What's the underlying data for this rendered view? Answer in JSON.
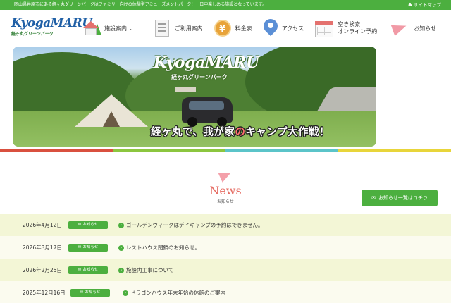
{
  "topbar": {
    "tagline": "岡山県井原市にある経ヶ丸グリーンパークはファミリー向けの体験型アミューズメントパーク！一日中楽しめる施設となっています。",
    "sitemap_label": "サイトマップ",
    "sitemap_icon": "sitemap-icon"
  },
  "logo": {
    "mark": "KyogaMARU",
    "sub": "経ヶ丸グリーンパーク"
  },
  "nav": {
    "items": [
      {
        "label": "施設案内",
        "icon": "facility-icon",
        "has_dropdown": true
      },
      {
        "label": "ご利用案内",
        "icon": "guide-document-icon"
      },
      {
        "label": "料金表",
        "icon": "yen-icon",
        "icon_glyph": "¥"
      },
      {
        "label": "アクセス",
        "icon": "map-pin-icon"
      },
      {
        "label": "空き検索\nオンライン予約",
        "icon": "calendar-icon"
      },
      {
        "label": "お知らせ",
        "icon": "megaphone-icon"
      }
    ],
    "dropdown_glyph": "⌄"
  },
  "hero": {
    "logo_mark": "KyogaMARU",
    "logo_sub": "経ヶ丸グリーンパーク",
    "catch_pre": "経ヶ丸で、我が家",
    "catch_accent": "の",
    "catch_post": "キャンプ大作戦！"
  },
  "stripe_colors": [
    "#d9503f",
    "#8cc63f",
    "#5bc4c9",
    "#e8d53a"
  ],
  "news": {
    "title": "News",
    "subtitle": "お知らせ",
    "list_button": "お知らせ一覧はコチラ",
    "badge_label": "お知らせ",
    "items": [
      {
        "date": "2026年4月12日",
        "title": "ゴールデンウィークはデイキャンプの予約はできません。"
      },
      {
        "date": "2026年3月17日",
        "title": "レストハウス閉鎖のお知らせ。"
      },
      {
        "date": "2026年2月25日",
        "title": "施設内工事について"
      },
      {
        "date": "2025年12月16日",
        "title": "ドラゴンハウス年末年始の休館のご案内"
      }
    ]
  },
  "colors": {
    "brand_green": "#4caf3f",
    "news_title": "#e56b62"
  }
}
